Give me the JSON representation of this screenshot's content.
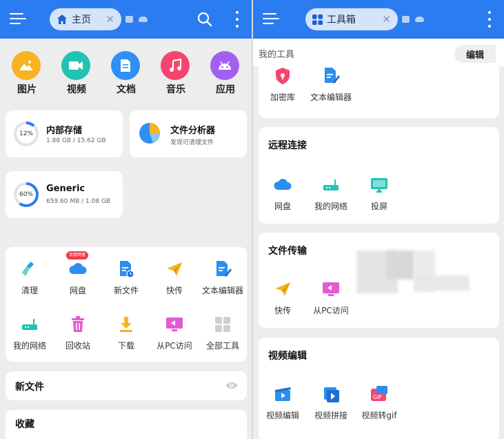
{
  "left": {
    "topbar": {
      "tab_label": "主页",
      "tab_close": "✕"
    },
    "categories": [
      {
        "label": "图片",
        "icon": "image-icon",
        "color": "#f7b321"
      },
      {
        "label": "视频",
        "icon": "video-icon",
        "color": "#22c3b2"
      },
      {
        "label": "文档",
        "icon": "document-icon",
        "color": "#2f8ff2"
      },
      {
        "label": "音乐",
        "icon": "music-icon",
        "color": "#f5456f"
      },
      {
        "label": "应用",
        "icon": "android-icon",
        "color": "#a35ff2"
      }
    ],
    "storage": [
      {
        "title": "内部存储",
        "sub": "1.88 GB / 15.62 GB",
        "percent_label": "12%",
        "percent": 12
      },
      {
        "title": "文件分析器",
        "sub": "发现可清理文件"
      },
      {
        "title": "Generic",
        "sub": "659.60 MB / 1.08 GB",
        "percent_label": "60%",
        "percent": 60
      }
    ],
    "badge": "百度网盘",
    "tools": [
      {
        "label": "清理",
        "icon": "clean-brush-icon"
      },
      {
        "label": "网盘",
        "icon": "cloud-icon"
      },
      {
        "label": "新文件",
        "icon": "new-file-icon"
      },
      {
        "label": "快传",
        "icon": "paper-plane-icon"
      },
      {
        "label": "文本编辑器",
        "icon": "text-editor-icon"
      },
      {
        "label": "我的网络",
        "icon": "router-icon"
      },
      {
        "label": "回收站",
        "icon": "trash-icon"
      },
      {
        "label": "下载",
        "icon": "download-icon"
      },
      {
        "label": "从PC访问",
        "icon": "pc-access-icon"
      },
      {
        "label": "全部工具",
        "icon": "grid-icon"
      }
    ],
    "new_files_title": "新文件",
    "favorites_title": "收藏"
  },
  "right": {
    "topbar": {
      "tab_label": "工具箱",
      "tab_close": "✕"
    },
    "my_tools_label": "我的工具",
    "edit_label": "编辑",
    "my_tools": [
      {
        "label": "加密库",
        "icon": "lock-icon"
      },
      {
        "label": "文本编辑器",
        "icon": "text-editor-icon"
      }
    ],
    "sections": [
      {
        "title": "远程连接",
        "items": [
          {
            "label": "网盘",
            "icon": "cloud-icon"
          },
          {
            "label": "我的网络",
            "icon": "router-icon"
          },
          {
            "label": "投屏",
            "icon": "cast-icon"
          }
        ]
      },
      {
        "title": "文件传输",
        "items": [
          {
            "label": "快传",
            "icon": "paper-plane-icon"
          },
          {
            "label": "从PC访问",
            "icon": "pc-access-icon"
          }
        ]
      },
      {
        "title": "视频编辑",
        "items": [
          {
            "label": "视频编辑",
            "icon": "video-edit-icon"
          },
          {
            "label": "视频拼接",
            "icon": "video-join-icon"
          },
          {
            "label": "视频转gif",
            "icon": "gif-icon"
          }
        ]
      }
    ]
  }
}
